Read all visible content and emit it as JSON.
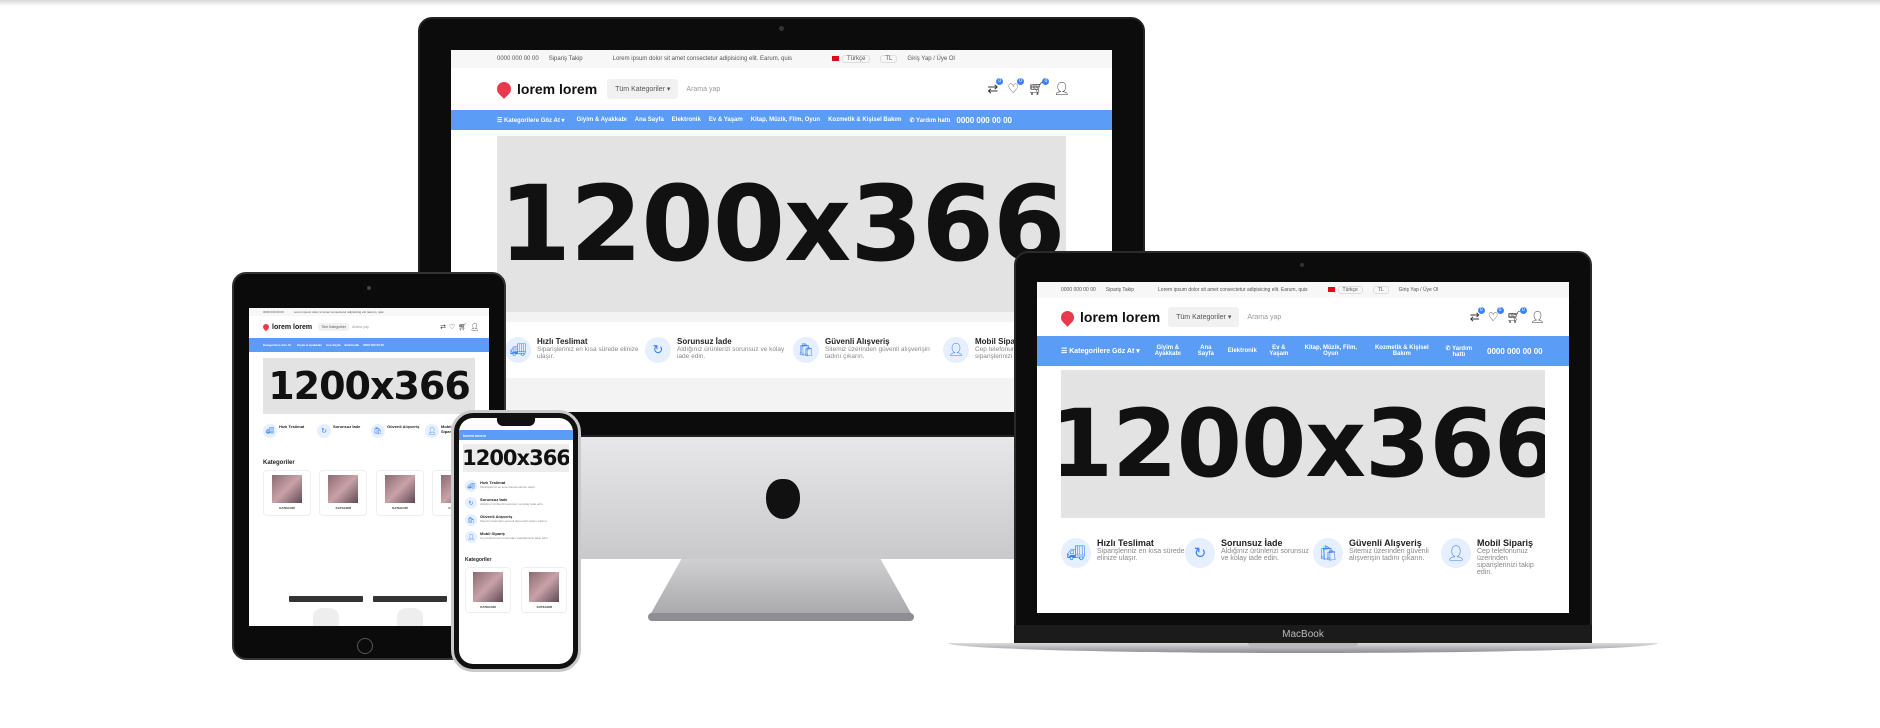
{
  "site": {
    "phone_top": "0000 000 00 00",
    "order_track": "Sipariş Takip",
    "announcement": "Lorem ipsum dolor sit amet consectetur adipisicing elit. Earum, quis",
    "language": "Türkçe",
    "currency": "TL",
    "account": "Giriş Yap / Üye Ol",
    "logo": "lorem lorem",
    "category_select": "Tüm Kategoriler",
    "search_placeholder": "Arama yap",
    "badge_compare": "0",
    "badge_fav": "0",
    "badge_cart": "0",
    "nav": {
      "all_categories": "Kategorilere Göz At",
      "items": [
        "Giyim & Ayakkabı",
        "Ana Sayfa",
        "Elektronik",
        "Ev & Yaşam",
        "Kitap, Müzik, Film, Oyun",
        "Kozmetik & Kişisel Bakım"
      ],
      "help": "Yardım hattı",
      "phone": "0000 000 00 00"
    },
    "banner": "1200x366",
    "features": [
      {
        "title": "Hızlı Teslimat",
        "text": "Siparişleriniz en kısa sürede elinize ulaşır."
      },
      {
        "title": "Sorunsuz İade",
        "text": "Aldığınız ürünlerizi sorunsuz ve kolay iade edin."
      },
      {
        "title": "Güvenli Alışveriş",
        "text": "Sitemiz üzerinden güvenli alışverişin tadını çıkarın."
      },
      {
        "title": "Mobil Sipariş",
        "text": "Cep telefonunuz üzerinden siparişlerinizi takip edin."
      }
    ],
    "categories_title": "Kategoriler",
    "category_label": "KATEGORİ"
  },
  "laptop_brand": "MacBook"
}
